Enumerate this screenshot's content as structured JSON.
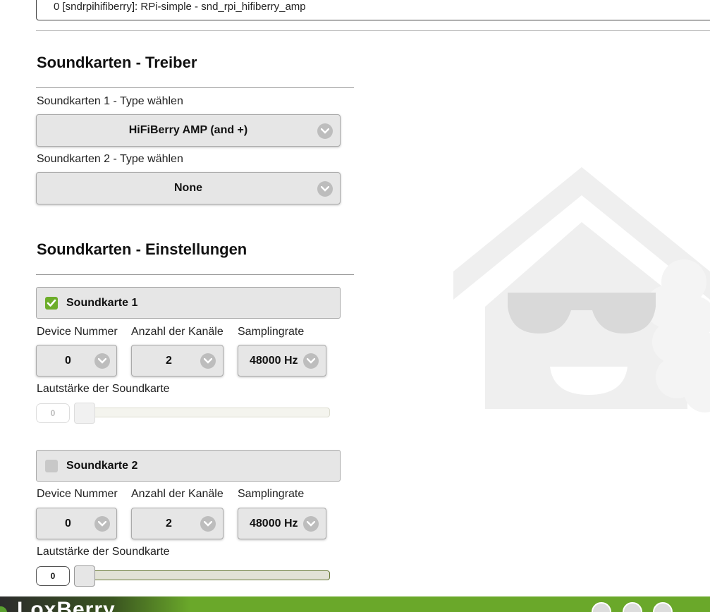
{
  "top_info": {
    "text": "0 [sndrpihifiberry]: RPi-simple - snd_rpi_hifiberry_amp"
  },
  "driver_section": {
    "title": "Soundkarten - Treiber",
    "card1_label": "Soundkarten 1 - Type wählen",
    "card1_value": "HiFiBerry AMP (and +)",
    "card2_label": "Soundkarten 2 - Type wählen",
    "card2_value": "None"
  },
  "settings_section": {
    "title": "Soundkarten - Einstellungen",
    "cards": [
      {
        "name": "Soundkarte 1",
        "enabled": true,
        "device_label": "Device Nummer",
        "device_value": "0",
        "channels_label": "Anzahl der Kanäle",
        "channels_value": "2",
        "rate_label": "Samplingrate",
        "rate_value": "48000 Hz",
        "volume_label": "Lautstärke der Soundkarte",
        "volume_value": "0"
      },
      {
        "name": "Soundkarte 2",
        "enabled": false,
        "device_label": "Device Nummer",
        "device_value": "0",
        "channels_label": "Anzahl der Kanäle",
        "channels_value": "2",
        "rate_label": "Samplingrate",
        "rate_value": "48000 Hz",
        "volume_label": "Lautstärke der Soundkarte",
        "volume_value": "0"
      }
    ]
  },
  "footer": {
    "brand": "LoxBerry"
  },
  "colors": {
    "accent_green": "#6dad2a",
    "bar_green": "#6aa82a",
    "select_bg": "#e6e6e6"
  },
  "icons": [
    "chevron-down-icon",
    "checkbox-checked-icon",
    "checkbox-unchecked-icon",
    "home-icon",
    "menu-icon",
    "power-icon",
    "loxberry-watermark"
  ]
}
